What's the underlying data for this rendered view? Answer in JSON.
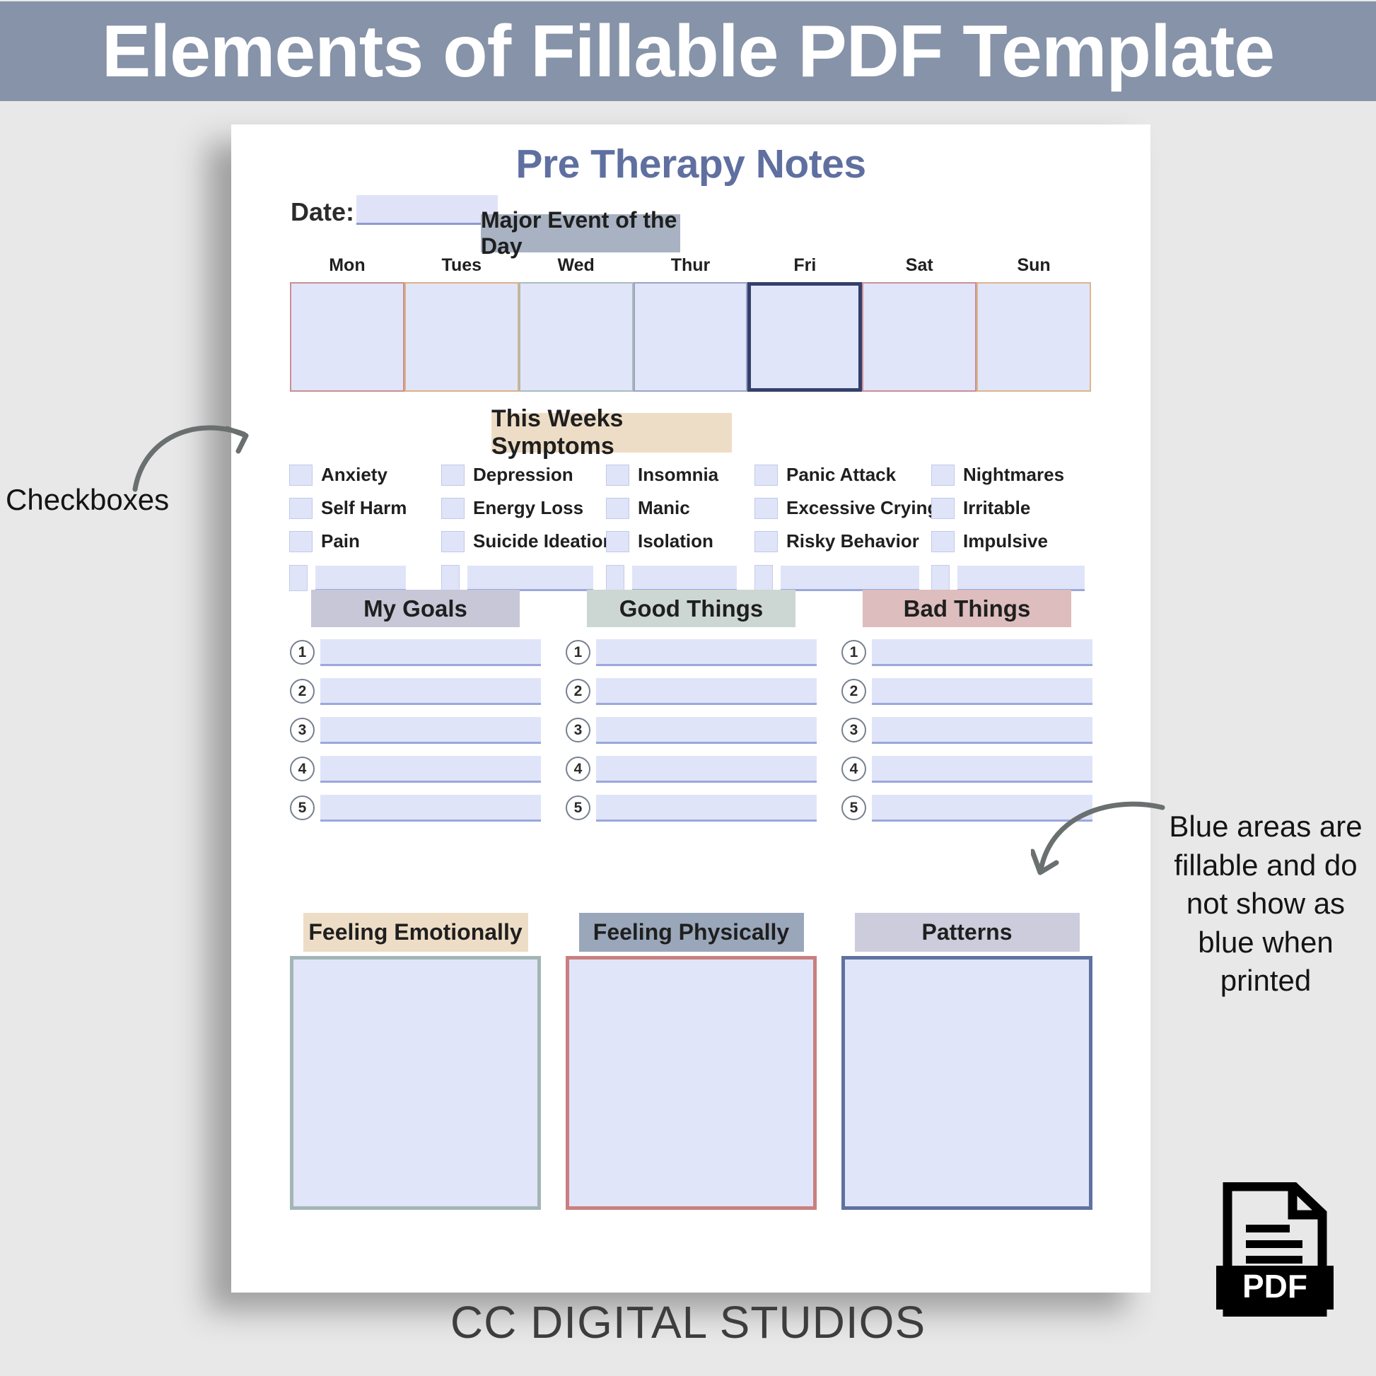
{
  "banner": {
    "title": "Elements of Fillable PDF Template",
    "bg": "#8693a8",
    "text_color": "#ffffff"
  },
  "document": {
    "title": "Pre Therapy Notes",
    "title_color": "#5f6fa0",
    "date": {
      "label": "Date:",
      "value": "",
      "placeholder": ""
    },
    "major_event": {
      "label": "Major Event of the Day",
      "bg": "#a8b2c2"
    },
    "weekdays": [
      {
        "name": "Mon",
        "border": "#c98f91"
      },
      {
        "name": "Tues",
        "border": "#dcb184"
      },
      {
        "name": "Wed",
        "border": "#a7bdbb"
      },
      {
        "name": "Thur",
        "border": "#9aa3c4"
      },
      {
        "name": "Fri",
        "border": "#33406b"
      },
      {
        "name": "Sat",
        "border": "#c98f98"
      },
      {
        "name": "Sun",
        "border": "#ddb68b"
      }
    ],
    "symptoms": {
      "header": "This Weeks Symptoms",
      "header_bg": "#eeddc6",
      "rows": [
        [
          "Anxiety",
          "Depression",
          "Insomnia",
          "Panic Attack",
          "Nightmares"
        ],
        [
          "Self Harm",
          "Energy Loss",
          "Manic",
          "Excessive Crying",
          "Irritable"
        ],
        [
          "Pain",
          "Suicide Ideation",
          "Isolation",
          "Risky Behavior",
          "Impulsive"
        ]
      ],
      "blank_row": [
        "",
        "",
        "",
        "",
        ""
      ]
    },
    "lists": [
      {
        "title": "My Goals",
        "bg": "#c7c7d8",
        "items": [
          "1",
          "2",
          "3",
          "4",
          "5"
        ]
      },
      {
        "title": "Good Things",
        "bg": "#ccd7d3",
        "items": [
          "1",
          "2",
          "3",
          "4",
          "5"
        ]
      },
      {
        "title": "Bad Things",
        "bg": "#ddbdbd",
        "items": [
          "1",
          "2",
          "3",
          "4",
          "5"
        ]
      }
    ],
    "bottom_boxes": [
      {
        "title": "Feeling Emotionally",
        "header_bg": "#eeddc6",
        "border": "#a3b5b5"
      },
      {
        "title": "Feeling Physically",
        "header_bg": "#9aa7ba",
        "border": "#c97f7f"
      },
      {
        "title": "Patterns",
        "header_bg": "#ccccdc",
        "border": "#5f72a0"
      }
    ],
    "fill_color": "#e1e5f9"
  },
  "annotations": {
    "left": "Checkboxes",
    "right": "Blue areas are fillable and do not show as blue when printed"
  },
  "footer": {
    "brand": "CC DIGITAL STUDIOS"
  },
  "pdf_icon": {
    "label": "PDF"
  }
}
